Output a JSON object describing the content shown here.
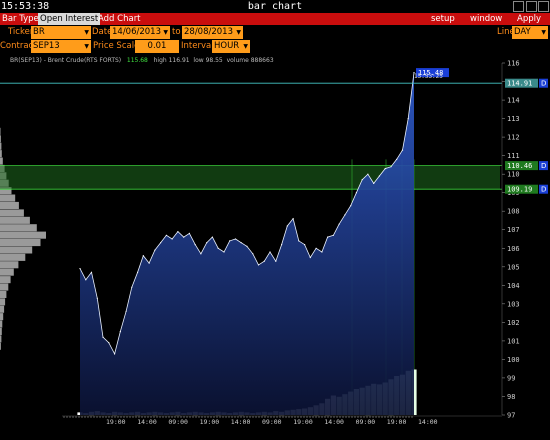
{
  "window": {
    "clock": "15:53:38",
    "title": "bar chart"
  },
  "menu": {
    "bar_type": "Bar Type",
    "open_interest": "Open Interest",
    "add_chart": "Add Chart",
    "setup": "setup",
    "window": "window",
    "apply": "Apply"
  },
  "controls": {
    "ticker_label": "Ticker",
    "ticker_value": "BR",
    "date_label": "Date",
    "date_from": "14/06/2013",
    "to_label": "to",
    "date_to": "28/08/2013",
    "line_label": "Line",
    "line_value": "DAY",
    "contract_label": "Contract",
    "contract_value": "SEP13",
    "price_scale_label": "Price Scale",
    "price_scale_value": "0.01",
    "interval_label": "Interval",
    "interval_value": "HOUR"
  },
  "chart_info": {
    "instrument": "BR(SEP13) - Brent Crude(RTS FORTS)",
    "last": "115.68",
    "high": "high 116.91",
    "low": "low 98.55",
    "volume": "volume 888663",
    "time_tag": "15:53:25"
  },
  "colors": {
    "menu_red": "#c90d0d",
    "field_orange": "#ff9c1a",
    "label_orange": "#ff8c1a",
    "band_green": "#1f6b1f",
    "price_fill_top": "#2f5ccf",
    "price_fill_bottom": "#0b1233",
    "last_price_tag": "#1a3fd6",
    "level_tag": "#1f7a1f"
  },
  "chart_data": {
    "type": "area",
    "title": "",
    "y_axis": {
      "min": 97,
      "max": 116,
      "ticks": [
        "116",
        "115",
        "114",
        "113",
        "112",
        "111",
        "110",
        "109",
        "108",
        "107",
        "106",
        "105",
        "104",
        "103",
        "102",
        "101",
        "100",
        "99",
        "98",
        "97"
      ]
    },
    "x_tick_labels": [
      "19:00",
      "14:00",
      "09:00",
      "19:00",
      "14:00",
      "09:00",
      "19:00",
      "14:00",
      "09:00",
      "19:00",
      "14:00"
    ],
    "price_tags": [
      {
        "label": "115.48",
        "type": "last"
      },
      {
        "label": "114.91",
        "type": "line"
      },
      {
        "label": "110.46",
        "type": "band-top"
      },
      {
        "label": "109.19",
        "type": "band-bottom"
      }
    ],
    "band": {
      "low": 109.19,
      "high": 110.46
    },
    "price": [
      104.9,
      104.3,
      104.7,
      103.3,
      101.2,
      100.9,
      100.3,
      101.5,
      102.6,
      103.9,
      104.7,
      105.6,
      105.2,
      105.9,
      106.3,
      106.7,
      106.5,
      106.9,
      106.6,
      106.8,
      106.2,
      105.7,
      106.3,
      106.6,
      106.0,
      105.8,
      106.4,
      106.5,
      106.3,
      106.1,
      105.7,
      105.1,
      105.3,
      105.8,
      105.3,
      106.2,
      107.2,
      107.6,
      106.4,
      106.2,
      105.5,
      106.0,
      105.8,
      106.6,
      106.7,
      107.3,
      107.8,
      108.3,
      109.0,
      109.7,
      110.0,
      109.5,
      109.9,
      110.3,
      110.4,
      110.8,
      111.3,
      113.0,
      115.48
    ],
    "volume": [
      0.04,
      0.03,
      0.05,
      0.06,
      0.04,
      0.03,
      0.05,
      0.04,
      0.03,
      0.04,
      0.05,
      0.03,
      0.04,
      0.05,
      0.04,
      0.03,
      0.04,
      0.05,
      0.03,
      0.04,
      0.05,
      0.04,
      0.03,
      0.04,
      0.05,
      0.04,
      0.03,
      0.04,
      0.05,
      0.04,
      0.03,
      0.04,
      0.05,
      0.04,
      0.06,
      0.05,
      0.07,
      0.08,
      0.09,
      0.1,
      0.12,
      0.15,
      0.18,
      0.25,
      0.3,
      0.28,
      0.32,
      0.36,
      0.4,
      0.42,
      0.45,
      0.48,
      0.47,
      0.5,
      0.55,
      0.6,
      0.62,
      0.68,
      0.7
    ],
    "profile": [
      0.01,
      0.02,
      0.03,
      0.04,
      0.06,
      0.1,
      0.14,
      0.19,
      0.25,
      0.33,
      0.41,
      0.52,
      0.65,
      0.8,
      1.0,
      0.88,
      0.7,
      0.55,
      0.4,
      0.3,
      0.23,
      0.18,
      0.14,
      0.11,
      0.09,
      0.07,
      0.05,
      0.04,
      0.03,
      0.02
    ]
  }
}
